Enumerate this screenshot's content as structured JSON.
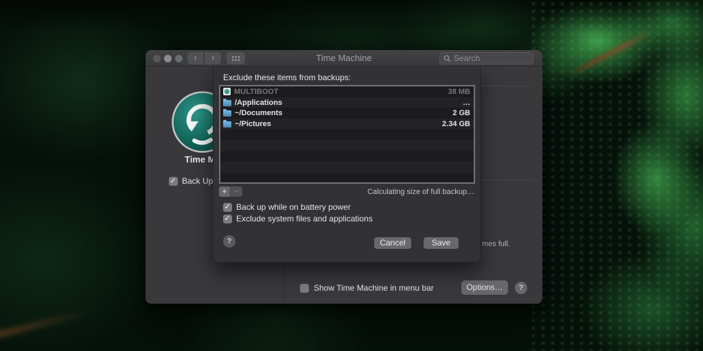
{
  "colors": {
    "window_bg": "#39393b",
    "titlebar_bg": "#404042",
    "sheet_bg": "#323234",
    "list_border": "#757579",
    "logo_teal": "#17695f",
    "folder_blue": "#5a9fd4",
    "foliage_green": "#2f8f45",
    "branch_brown": "#6b4423",
    "traffic_light_1": "#57585a",
    "traffic_light_2": "#8b8d8e",
    "traffic_light_3": "#6b6d6f"
  },
  "window": {
    "titlebar": {
      "title": "Time Machine",
      "back_icon": "‹",
      "forward_icon": "›",
      "search_placeholder": "Search"
    },
    "sidebar": {
      "app_label_fragment": "Time M",
      "backup_checkbox_fragment": "Back Up",
      "backup_checkbox_checked": true
    },
    "underlying_text_fragment": "mes full.",
    "footer": {
      "menu_bar_checkbox_label": "Show Time Machine in menu bar",
      "menu_bar_checkbox_checked": false,
      "options_button_label": "Options…",
      "help_button_label": "?"
    }
  },
  "sheet": {
    "title": "Exclude these items from backups:",
    "list": {
      "visible_rows": 9,
      "items": [
        {
          "name": "MULTIBOOT",
          "size": "38 MB",
          "icon": "drive-icon",
          "disabled": true
        },
        {
          "name": "/Applications",
          "size": "…",
          "icon": "folder-icon",
          "disabled": false
        },
        {
          "name": "~/Documents",
          "size": "2 GB",
          "icon": "folder-icon",
          "disabled": false
        },
        {
          "name": "~/Pictures",
          "size": "2.34 GB",
          "icon": "folder-icon",
          "disabled": false
        }
      ]
    },
    "add_button_label": "+",
    "remove_button_label": "−",
    "status_text": "Calculating size of full backup…",
    "checkboxes": [
      {
        "label": "Back up while on battery power",
        "checked": true
      },
      {
        "label": "Exclude system files and applications",
        "checked": true
      }
    ],
    "help_button_label": "?",
    "cancel_button_label": "Cancel",
    "save_button_label": "Save"
  }
}
